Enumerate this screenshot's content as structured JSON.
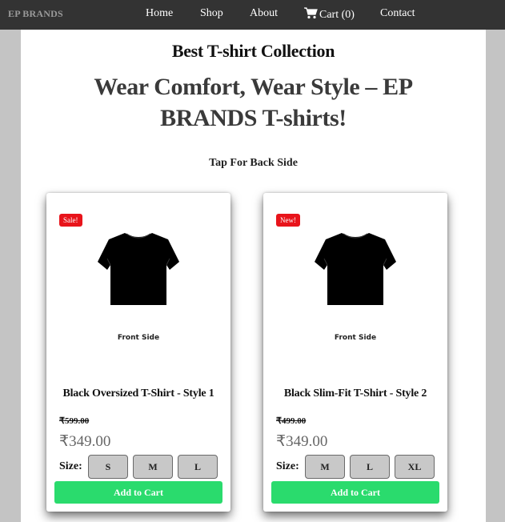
{
  "nav": {
    "brand": "EP BRANDS",
    "links": [
      "Home",
      "Shop",
      "About"
    ],
    "cart_label": "Cart",
    "cart_count": "(0)",
    "contact": "Contact"
  },
  "hero": {
    "title": "Best T-shirt Collection",
    "tagline": "Wear Comfort, Wear Style – EP BRANDS T-shirts!",
    "hint": "Tap For Back Side"
  },
  "products": [
    {
      "badge": "Sale!",
      "side_label": "Front Side",
      "name": "Black Oversized T-Shirt - Style 1",
      "old_price": "₹599.00",
      "price": "₹349.00",
      "size_label": "Size:",
      "sizes": [
        "S",
        "M",
        "L"
      ],
      "add_label": "Add to Cart"
    },
    {
      "badge": "New!",
      "side_label": "Front Side",
      "name": "Black Slim-Fit T-Shirt - Style 2",
      "old_price": "₹499.00",
      "price": "₹349.00",
      "size_label": "Size:",
      "sizes": [
        "M",
        "L",
        "XL"
      ],
      "add_label": "Add to Cart"
    }
  ],
  "colors": {
    "navbar": "#333333",
    "badge": "#e8141b",
    "add_to_cart": "#2adb6d"
  },
  "icons": [
    "cart-icon",
    "tshirt-image"
  ]
}
